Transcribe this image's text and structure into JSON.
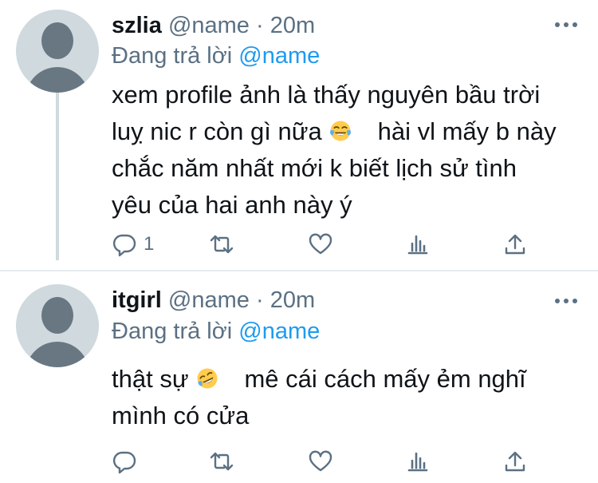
{
  "tweets": [
    {
      "display_name": "szlia",
      "handle": "@name",
      "separator": "·",
      "time": "20m",
      "replying_prefix": "Đang trả lời",
      "replying_to": "@name",
      "lines": [
        "xem profile ảnh là thấy nguyên bầu trời",
        "luỵ nic r còn gì nữa",
        "hài vl mấy b này",
        "chắc năm nhất mới k biết lịch sử tình",
        "yêu của hai anh này ý"
      ],
      "emoji": "face-with-tears-of-joy",
      "reply_count": "1",
      "icons": [
        "reply-icon",
        "retweet-icon",
        "like-icon",
        "analytics-icon",
        "share-icon"
      ]
    },
    {
      "display_name": "itgirl",
      "handle": "@name",
      "separator": "·",
      "time": "20m",
      "replying_prefix": "Đang trả lời",
      "replying_to": "@name",
      "lines": [
        "thật sự",
        "mê cái cách mấy ẻm nghĩ",
        "mình có cửa"
      ],
      "emoji": "rolling-on-the-floor-laughing",
      "reply_count": "",
      "icons": [
        "reply-icon",
        "retweet-icon",
        "like-icon",
        "analytics-icon",
        "share-icon"
      ]
    }
  ],
  "colors": {
    "text": "#0f1419",
    "secondary": "#5b7083",
    "link": "#1d9bf0",
    "avatar_bg": "#cfd9de",
    "avatar_fg": "#687782",
    "divider": "#e6ecf0"
  }
}
